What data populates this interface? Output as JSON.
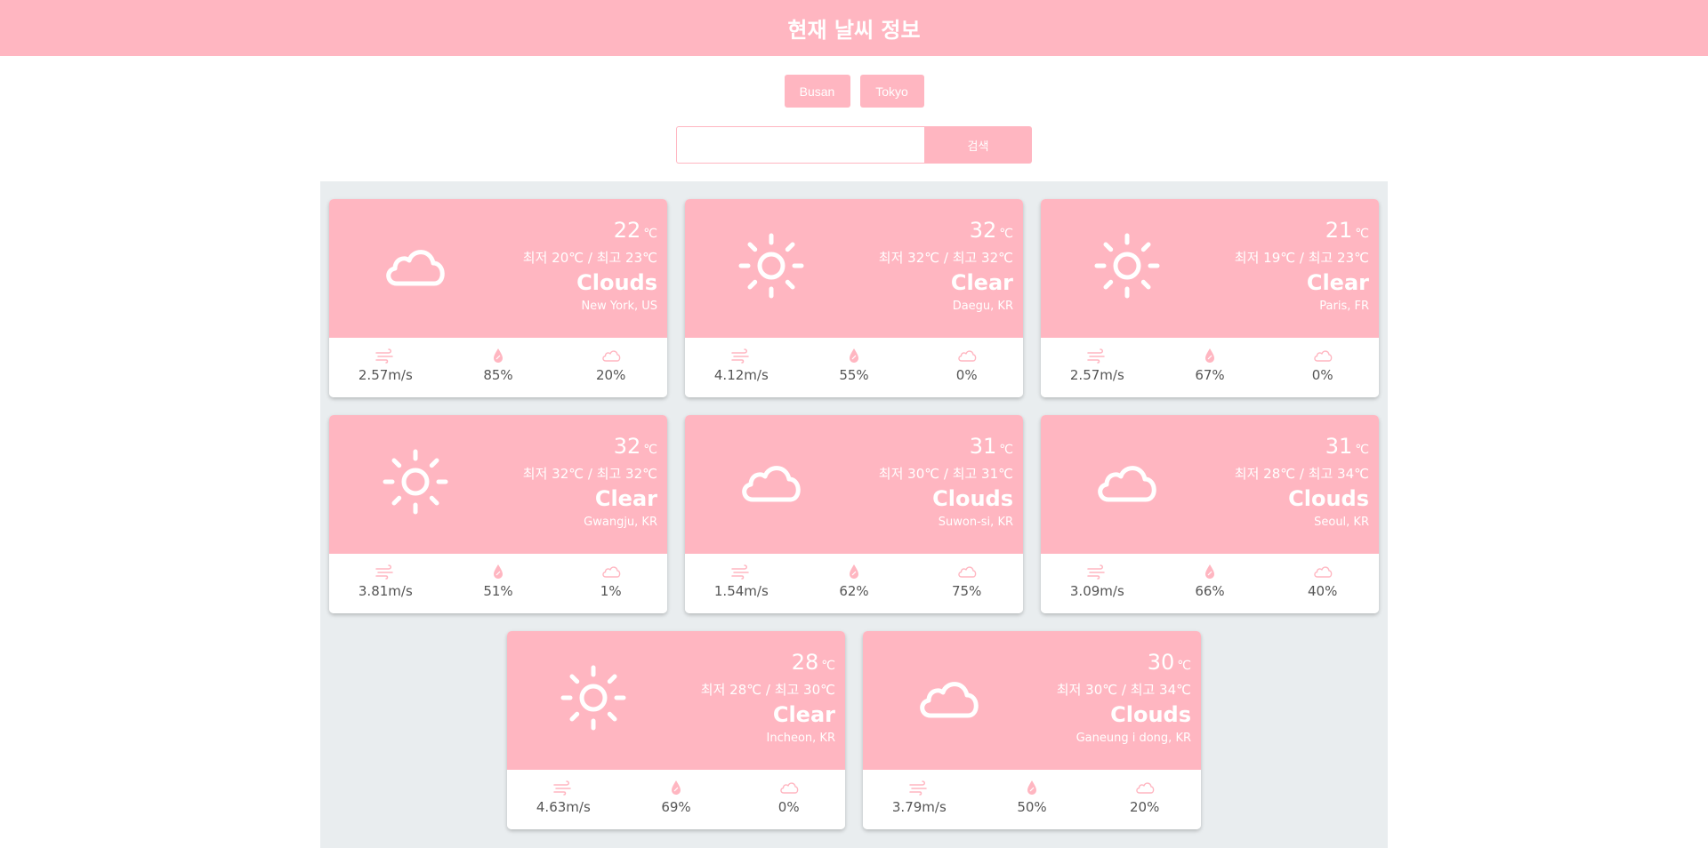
{
  "header": {
    "title": "현재 날씨 정보"
  },
  "city_buttons": [
    "Busan",
    "Tokyo"
  ],
  "search": {
    "value": "",
    "placeholder": "",
    "button_label": "검색"
  },
  "unit": "℃",
  "cards": [
    {
      "temp": "22",
      "min_max": "최저 20℃ / 최고 23℃",
      "desc": "Clouds",
      "location": "New York, US",
      "icon": "cloud-icon",
      "wind": "2.57m/s",
      "humidity": "85%",
      "cloudiness": "20%"
    },
    {
      "temp": "32",
      "min_max": "최저 32℃ / 최고 32℃",
      "desc": "Clear",
      "location": "Daegu, KR",
      "icon": "sun-icon",
      "wind": "4.12m/s",
      "humidity": "55%",
      "cloudiness": "0%"
    },
    {
      "temp": "21",
      "min_max": "최저 19℃ / 최고 23℃",
      "desc": "Clear",
      "location": "Paris, FR",
      "icon": "sun-icon",
      "wind": "2.57m/s",
      "humidity": "67%",
      "cloudiness": "0%"
    },
    {
      "temp": "32",
      "min_max": "최저 32℃ / 최고 32℃",
      "desc": "Clear",
      "location": "Gwangju, KR",
      "icon": "sun-icon",
      "wind": "3.81m/s",
      "humidity": "51%",
      "cloudiness": "1%"
    },
    {
      "temp": "31",
      "min_max": "최저 30℃ / 최고 31℃",
      "desc": "Clouds",
      "location": "Suwon-si, KR",
      "icon": "cloud-icon",
      "wind": "1.54m/s",
      "humidity": "62%",
      "cloudiness": "75%"
    },
    {
      "temp": "31",
      "min_max": "최저 28℃ / 최고 34℃",
      "desc": "Clouds",
      "location": "Seoul, KR",
      "icon": "cloud-icon",
      "wind": "3.09m/s",
      "humidity": "66%",
      "cloudiness": "40%"
    },
    {
      "temp": "28",
      "min_max": "최저 28℃ / 최고 30℃",
      "desc": "Clear",
      "location": "Incheon, KR",
      "icon": "sun-icon",
      "wind": "4.63m/s",
      "humidity": "69%",
      "cloudiness": "0%"
    },
    {
      "temp": "30",
      "min_max": "최저 30℃ / 최고 34℃",
      "desc": "Clouds",
      "location": "Ganeung i dong, KR",
      "icon": "cloud-icon",
      "wind": "3.79m/s",
      "humidity": "50%",
      "cloudiness": "20%"
    }
  ],
  "colors": {
    "accent": "#ffb6c1",
    "grid_background": "#e9edef",
    "stat_text": "#555555"
  }
}
